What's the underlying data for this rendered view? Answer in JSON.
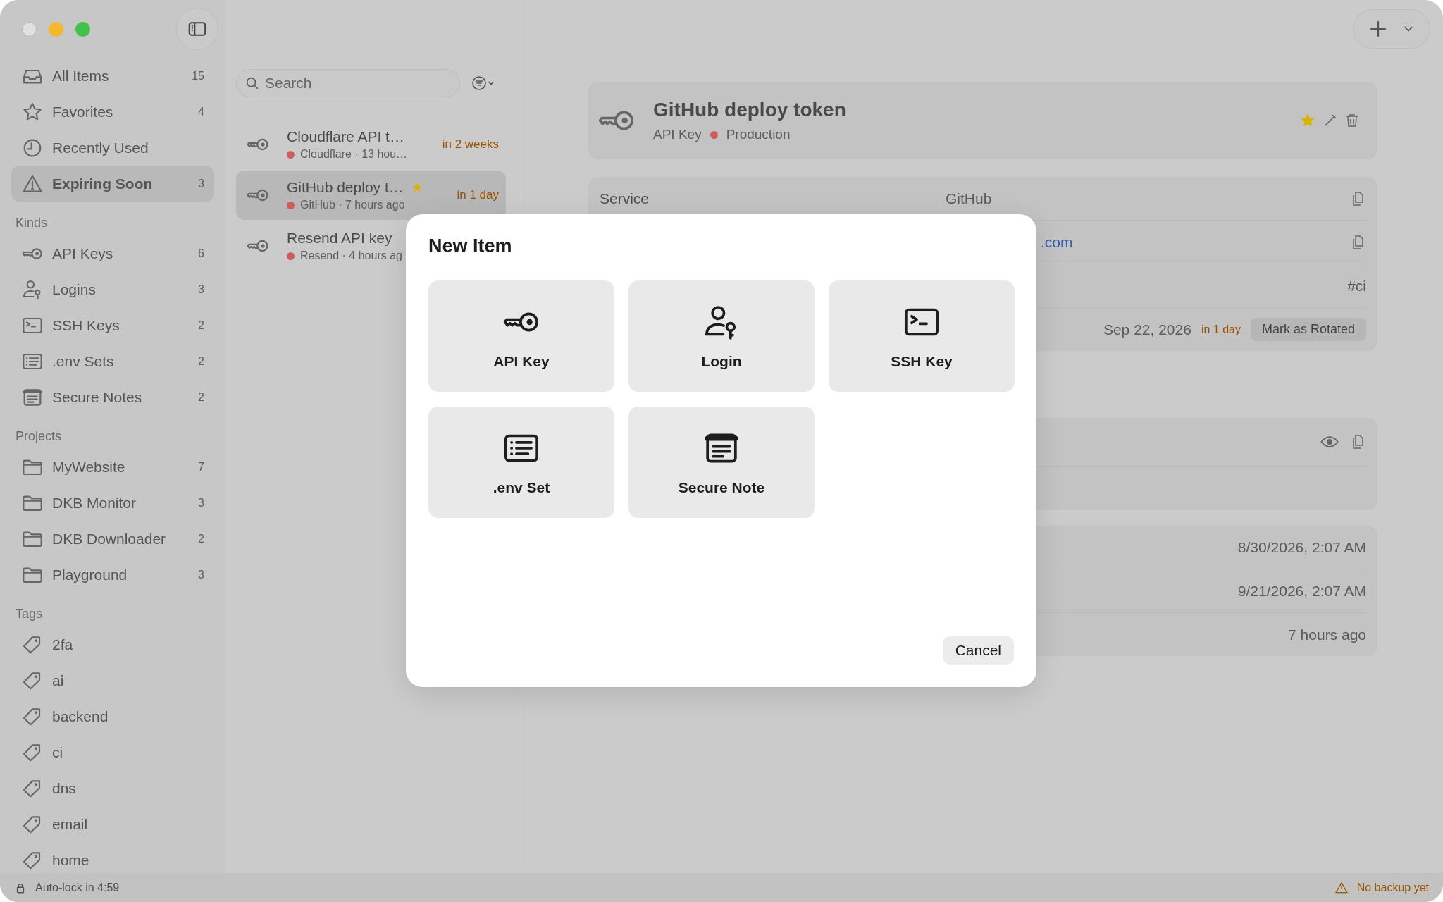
{
  "sidebar": {
    "sections": [
      {
        "items": [
          {
            "kind": "all",
            "label": "All Items",
            "count": "15",
            "selected": false
          },
          {
            "kind": "favorites",
            "label": "Favorites",
            "count": "4",
            "selected": false
          },
          {
            "kind": "recent",
            "label": "Recently Used",
            "selected": false
          },
          {
            "kind": "expiring",
            "label": "Expiring Soon",
            "count": "3",
            "selected": true
          }
        ]
      },
      {
        "title": "Kinds",
        "items": [
          {
            "kind": "api-key",
            "label": "API Keys",
            "count": "6",
            "selected": false
          },
          {
            "kind": "login",
            "label": "Logins",
            "count": "3",
            "selected": false
          },
          {
            "kind": "ssh-key",
            "label": "SSH Keys",
            "count": "2",
            "selected": false
          },
          {
            "kind": "env-set",
            "label": ".env Sets",
            "count": "2",
            "selected": false
          },
          {
            "kind": "note",
            "label": "Secure Notes",
            "count": "2",
            "selected": false
          }
        ]
      },
      {
        "title": "Projects",
        "items": [
          {
            "kind": "project",
            "label": "MyWebsite",
            "count": "7",
            "selected": false
          },
          {
            "kind": "project",
            "label": "DKB Monitor",
            "count": "3",
            "selected": false
          },
          {
            "kind": "project",
            "label": "DKB Downloader",
            "count": "2",
            "selected": false
          },
          {
            "kind": "project",
            "label": "Playground",
            "count": "3",
            "selected": false
          }
        ]
      },
      {
        "title": "Tags",
        "items": [
          {
            "kind": "tag",
            "label": "2fa",
            "selected": false
          },
          {
            "kind": "tag",
            "label": "ai",
            "selected": false
          },
          {
            "kind": "tag",
            "label": "backend",
            "selected": false
          },
          {
            "kind": "tag",
            "label": "ci",
            "selected": false
          },
          {
            "kind": "tag",
            "label": "dns",
            "selected": false
          },
          {
            "kind": "tag",
            "label": "email",
            "selected": false
          },
          {
            "kind": "tag",
            "label": "home",
            "selected": false
          }
        ]
      }
    ]
  },
  "list": {
    "search": {
      "placeholder": "Search"
    },
    "items": [
      {
        "title": "Cloudflare API t…",
        "subtitle": "Cloudflare · 13 hou…",
        "due": "in 2 weeks",
        "favorite": false,
        "selected": false
      },
      {
        "title": "GitHub deploy t…",
        "subtitle": "GitHub · 7 hours ago",
        "due": "in 1 day",
        "favorite": true,
        "selected": true
      },
      {
        "title": "Resend API key",
        "subtitle": "Resend · 4 hours ag",
        "favorite": false,
        "selected": false
      }
    ]
  },
  "detail": {
    "title": "GitHub deploy token",
    "kind_label": "API Key",
    "environment": "Production",
    "favorite": true,
    "fields": [
      {
        "kind": "text",
        "label": "Service",
        "value": "GitHub"
      },
      {
        "kind": "link",
        "value": ".com"
      },
      {
        "kind": "tags",
        "value": "#ci"
      },
      {
        "kind": "expiry",
        "value": "Sep 22, 2026",
        "due": "in 1 day",
        "action": "Mark as Rotated"
      }
    ],
    "metadata": [
      "8/30/2026, 2:07 AM",
      "9/21/2026, 2:07 AM",
      "7 hours ago"
    ]
  },
  "dialog": {
    "title": "New Item",
    "options": [
      {
        "kind": "api-key",
        "label": "API Key"
      },
      {
        "kind": "login",
        "label": "Login"
      },
      {
        "kind": "ssh-key",
        "label": "SSH Key"
      },
      {
        "kind": "env-set",
        "label": ".env Set"
      },
      {
        "kind": "note",
        "label": "Secure Note"
      }
    ],
    "cancel": "Cancel"
  },
  "status_bar": {
    "autolock": "Auto-lock in 4:59",
    "backup": "No backup yet"
  }
}
